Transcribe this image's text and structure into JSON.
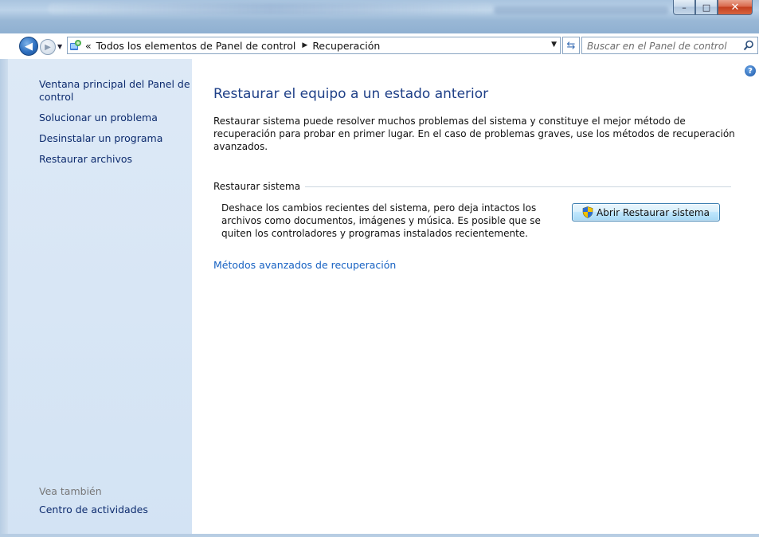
{
  "window": {
    "title_blurred": "",
    "buttons": {
      "minimize": "–",
      "maximize": "□",
      "close": "✕"
    }
  },
  "nav": {
    "back_icon": "back-arrow-icon",
    "forward_icon": "forward-arrow-icon",
    "breadcrumb_prefix": "«",
    "crumbs": [
      "Todos los elementos de Panel de control",
      "Recuperación"
    ],
    "search_placeholder": "Buscar en el Panel de control"
  },
  "sidebar": {
    "links": [
      "Ventana principal del Panel de control",
      "Solucionar un problema",
      "Desinstalar un programa",
      "Restaurar archivos"
    ],
    "see_also_heading": "Vea también",
    "see_also_links": [
      "Centro de actividades"
    ]
  },
  "main": {
    "title": "Restaurar el equipo a un estado anterior",
    "description": "Restaurar sistema puede resolver muchos problemas del sistema y constituye el mejor método de recuperación para probar en primer lugar. En el caso de problemas graves, use los métodos de recuperación avanzados.",
    "section_heading": "Restaurar sistema",
    "section_description": "Deshace los cambios recientes del sistema, pero deja intactos los archivos como documentos, imágenes y música. Es posible que se quiten los controladores y programas instalados recientemente.",
    "open_button_label": "Abrir Restaurar sistema",
    "advanced_link": "Métodos avanzados de recuperación"
  },
  "colors": {
    "title_blue": "#1e3f87",
    "link_blue": "#1762c3",
    "sidebar_bg": "#d3e3f4"
  }
}
